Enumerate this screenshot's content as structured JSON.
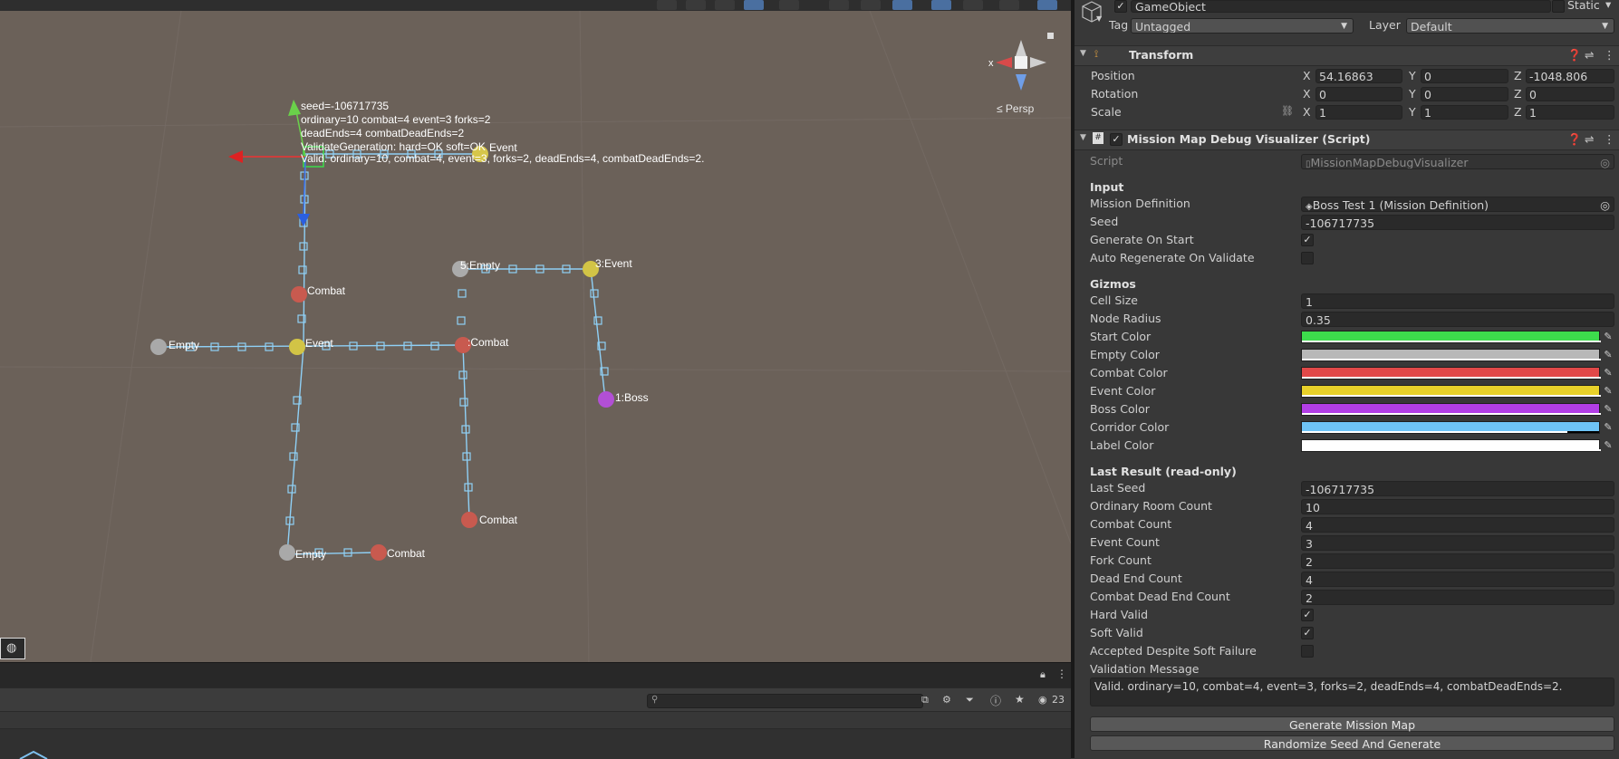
{
  "scene": {
    "overlay_lines": [
      "seed=-106717735",
      "ordinary=10  combat=4  event=3  forks=2",
      "deadEnds=4  combatDeadEnds=2",
      "ValidateGeneration: hard=OK soft=OK",
      "Valid. ordinary=10, combat=4, event=3, forks=2, deadEnds=4, combatDeadEnds=2."
    ],
    "gizmo_x_label": "x",
    "persp_label": "≤ Persp",
    "node_labels": {
      "start_event": "Event",
      "combat_a": "Combat",
      "empty_left": "Empty",
      "event_center": "Event",
      "combat_mid": ":Combat",
      "empty_top": "5:Empty",
      "event_top": "3:Event",
      "boss": "1:Boss",
      "combat_bottom_right": "Combat",
      "empty_bottom": "Empty",
      "combat_bottom": "Combat"
    },
    "colors": {
      "start": "#3ddc4c",
      "empty": "#b8b8b8",
      "combat": "#e14848",
      "event": "#e8d12a",
      "boss": "#b23ee6",
      "corridor": "#6ec4f6",
      "label": "#ffffff"
    }
  },
  "console": {
    "count": "23"
  },
  "inspector": {
    "gameobject_name": "GameObject",
    "static_label": "Static",
    "tag_label": "Tag",
    "tag_value": "Untagged",
    "layer_label": "Layer",
    "layer_value": "Default",
    "transform": {
      "title": "Transform",
      "position_label": "Position",
      "rotation_label": "Rotation",
      "scale_label": "Scale",
      "pos": {
        "x": "54.16863",
        "y": "0",
        "z": "-1048.806"
      },
      "rot": {
        "x": "0",
        "y": "0",
        "z": "0"
      },
      "scale": {
        "x": "1",
        "y": "1",
        "z": "1"
      },
      "axis_x": "X",
      "axis_y": "Y",
      "axis_z": "Z"
    },
    "script_component": {
      "title": "Mission Map Debug Visualizer (Script)",
      "script_label": "Script",
      "script_value": "MissionMapDebugVisualizer",
      "input_header": "Input",
      "mission_def_label": "Mission Definition",
      "mission_def_value": "Boss Test 1 (Mission Definition)",
      "seed_label": "Seed",
      "seed_value": "-106717735",
      "generate_on_start_label": "Generate On Start",
      "auto_regen_label": "Auto Regenerate On Validate",
      "gizmos_header": "Gizmos",
      "cell_size_label": "Cell Size",
      "cell_size_value": "1",
      "node_radius_label": "Node Radius",
      "node_radius_value": "0.35",
      "start_color_label": "Start Color",
      "empty_color_label": "Empty Color",
      "combat_color_label": "Combat Color",
      "event_color_label": "Event Color",
      "boss_color_label": "Boss Color",
      "corridor_color_label": "Corridor Color",
      "label_color_label": "Label Color",
      "last_result_header": "Last Result (read-only)",
      "last_seed_label": "Last Seed",
      "last_seed_value": "-106717735",
      "ordinary_label": "Ordinary Room Count",
      "ordinary_value": "10",
      "combat_count_label": "Combat Count",
      "combat_count_value": "4",
      "event_count_label": "Event Count",
      "event_count_value": "3",
      "fork_count_label": "Fork Count",
      "fork_count_value": "2",
      "dead_end_label": "Dead End Count",
      "dead_end_value": "4",
      "combat_dead_end_label": "Combat Dead End Count",
      "combat_dead_end_value": "2",
      "hard_valid_label": "Hard Valid",
      "soft_valid_label": "Soft Valid",
      "accepted_label": "Accepted Despite Soft Failure",
      "validation_msg_label": "Validation Message",
      "validation_msg_value": "Valid. ordinary=10, combat=4, event=3, forks=2, deadEnds=4, combatDeadEnds=2.",
      "generate_button": "Generate Mission Map",
      "randomize_button": "Randomize Seed And Generate"
    }
  },
  "checkmark": "✓"
}
